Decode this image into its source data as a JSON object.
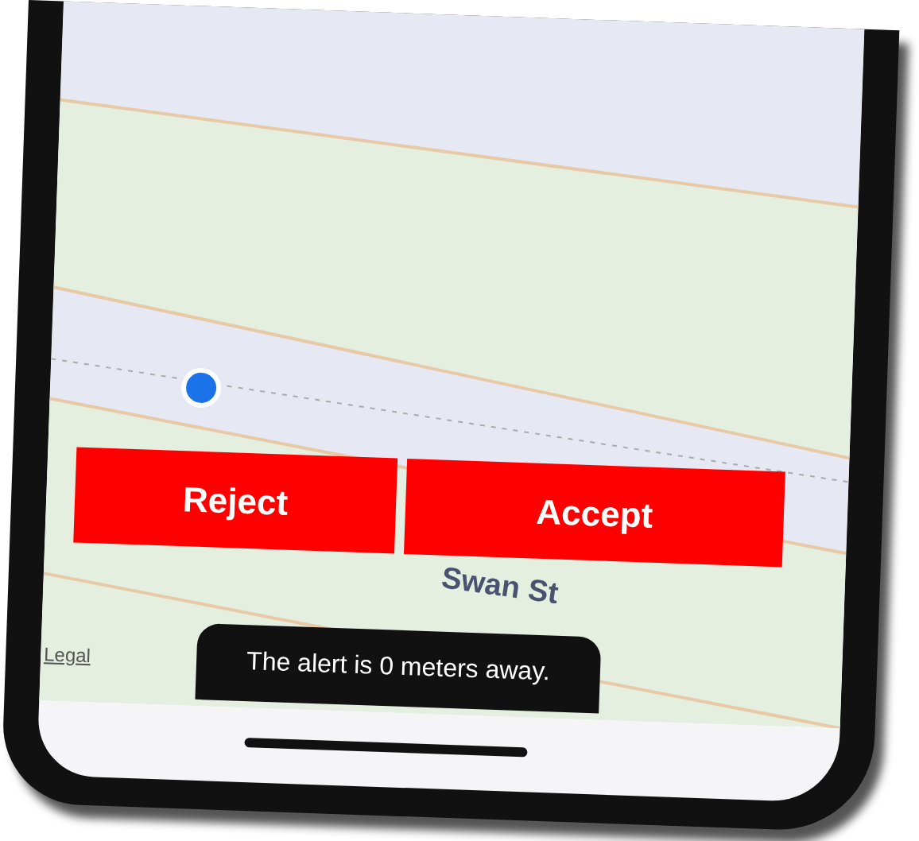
{
  "map": {
    "street_label": "Swan St",
    "legal_link": "Legal"
  },
  "buttons": [
    {
      "label": "Reject"
    },
    {
      "label": "Accept"
    }
  ],
  "toast": "The alert is 0 meters away."
}
